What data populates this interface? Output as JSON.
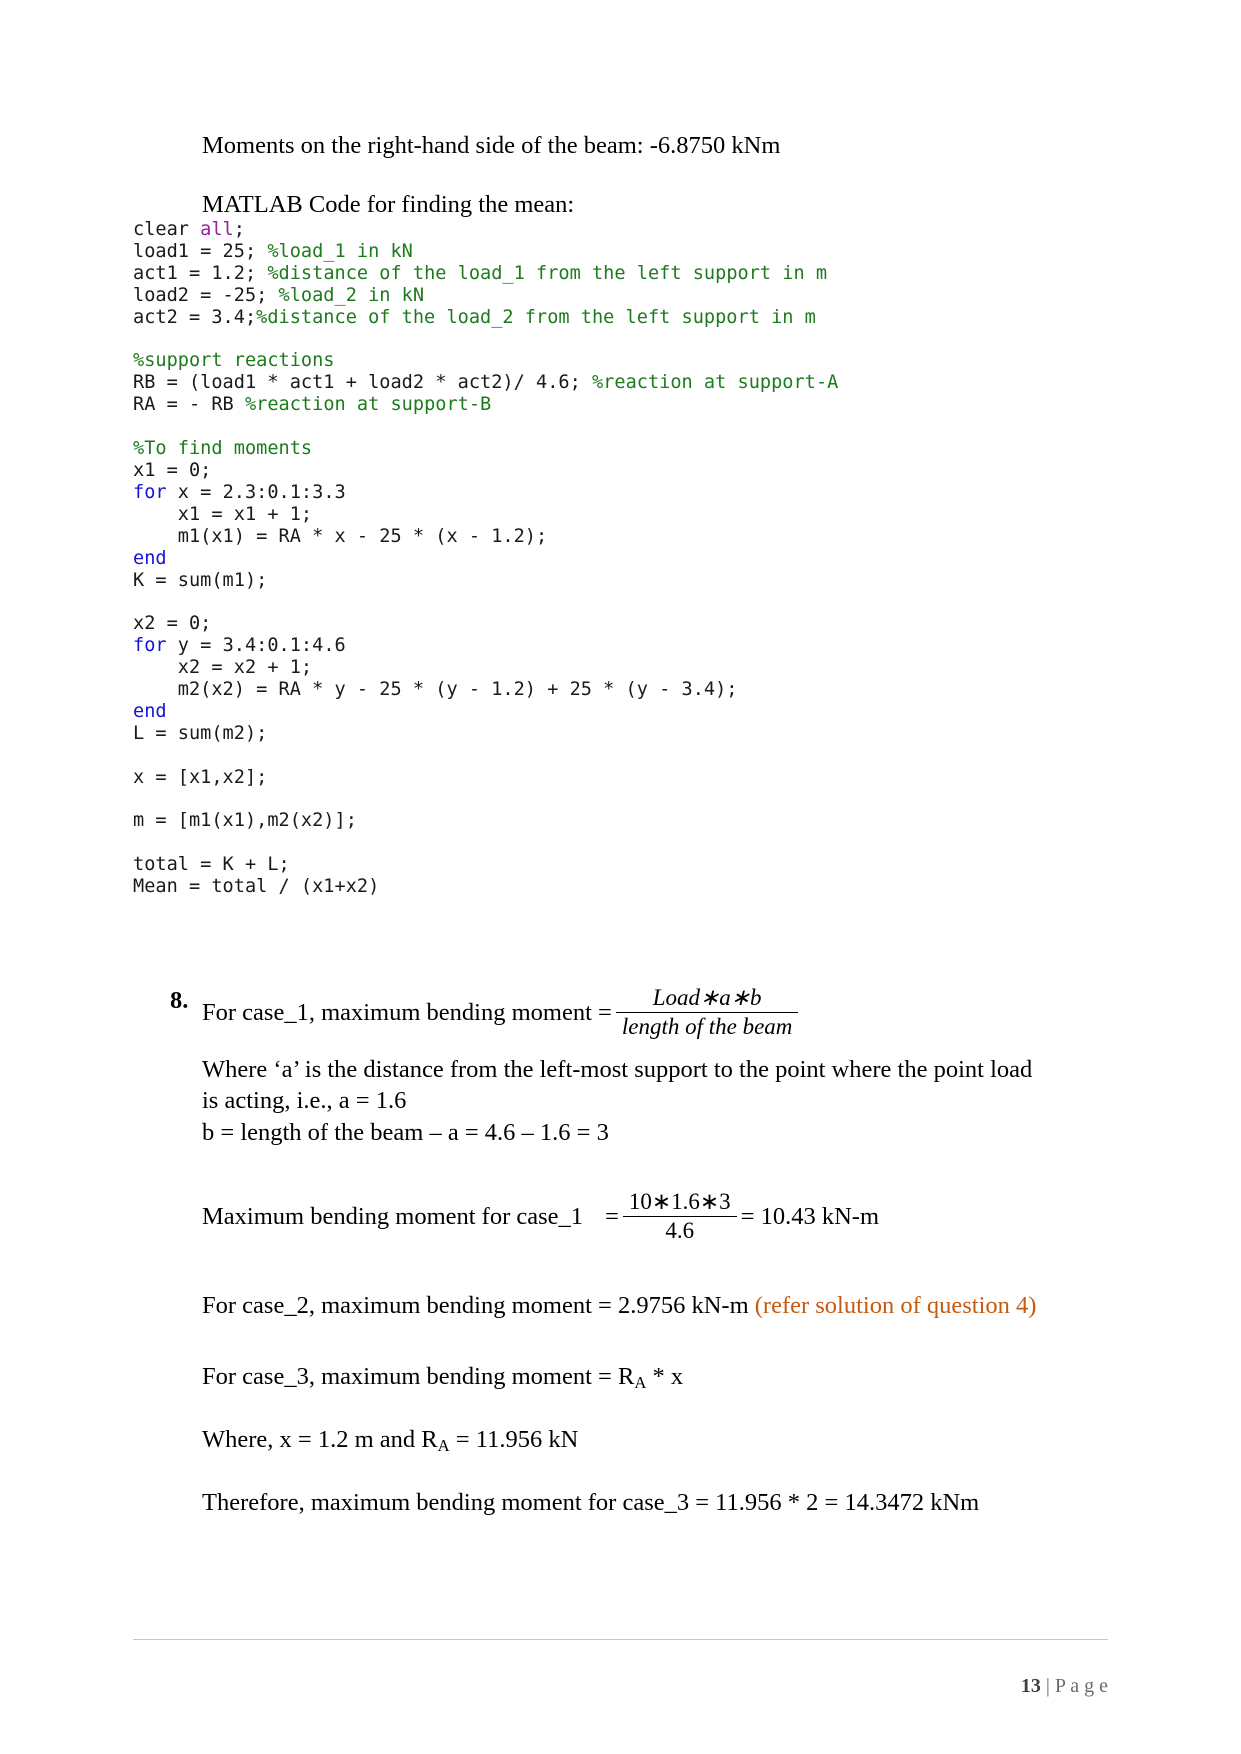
{
  "document": {
    "intro_lines": [
      "Moments on the right-hand side of the beam: -6.8750 kNm",
      "MATLAB Code for finding the mean:"
    ],
    "code": {
      "lines": [
        {
          "segments": [
            {
              "t": "clear ",
              "c": "plain"
            },
            {
              "t": "all",
              "c": "kw2"
            },
            {
              "t": ";",
              "c": "plain"
            }
          ]
        },
        {
          "segments": [
            {
              "t": "load1 = 25; ",
              "c": "plain"
            },
            {
              "t": "%load_1 in kN",
              "c": "cmt"
            }
          ]
        },
        {
          "segments": [
            {
              "t": "act1 = 1.2; ",
              "c": "plain"
            },
            {
              "t": "%distance of the load_1 from the left support in m",
              "c": "cmt"
            }
          ]
        },
        {
          "segments": [
            {
              "t": "load2 = -25; ",
              "c": "plain"
            },
            {
              "t": "%load_2 in kN",
              "c": "cmt"
            }
          ]
        },
        {
          "segments": [
            {
              "t": "act2 = 3.4;",
              "c": "plain"
            },
            {
              "t": "%distance of the load_2 from the left support in m",
              "c": "cmt"
            }
          ]
        },
        {
          "segments": [
            {
              "t": "",
              "c": "plain"
            }
          ]
        },
        {
          "segments": [
            {
              "t": "%support reactions",
              "c": "cmt"
            }
          ]
        },
        {
          "segments": [
            {
              "t": "RB = (load1 * act1 + load2 * act2)/ 4.6; ",
              "c": "plain"
            },
            {
              "t": "%reaction at support-A",
              "c": "cmt"
            }
          ]
        },
        {
          "segments": [
            {
              "t": "RA = - RB ",
              "c": "plain"
            },
            {
              "t": "%reaction at support-B",
              "c": "cmt"
            }
          ]
        },
        {
          "segments": [
            {
              "t": "",
              "c": "plain"
            }
          ]
        },
        {
          "segments": [
            {
              "t": "%To find moments",
              "c": "cmt"
            }
          ]
        },
        {
          "segments": [
            {
              "t": "x1 = 0;",
              "c": "plain"
            }
          ]
        },
        {
          "segments": [
            {
              "t": "for",
              "c": "kw"
            },
            {
              "t": " x = 2.3:0.1:3.3",
              "c": "plain"
            }
          ]
        },
        {
          "segments": [
            {
              "t": "    x1 = x1 + 1;",
              "c": "plain"
            }
          ]
        },
        {
          "segments": [
            {
              "t": "    m1(x1) = RA * x - 25 * (x - 1.2);",
              "c": "plain"
            }
          ]
        },
        {
          "segments": [
            {
              "t": "end",
              "c": "kw"
            }
          ]
        },
        {
          "segments": [
            {
              "t": "K = sum(m1);",
              "c": "plain"
            }
          ]
        },
        {
          "segments": [
            {
              "t": "",
              "c": "plain"
            }
          ]
        },
        {
          "segments": [
            {
              "t": "x2 = 0;",
              "c": "plain"
            }
          ]
        },
        {
          "segments": [
            {
              "t": "for",
              "c": "kw"
            },
            {
              "t": " y = 3.4:0.1:4.6",
              "c": "plain"
            }
          ]
        },
        {
          "segments": [
            {
              "t": "    x2 = x2 + 1;",
              "c": "plain"
            }
          ]
        },
        {
          "segments": [
            {
              "t": "    m2(x2) = RA * y - 25 * (y - 1.2) + 25 * (y - 3.4);",
              "c": "plain"
            }
          ]
        },
        {
          "segments": [
            {
              "t": "end",
              "c": "kw"
            }
          ]
        },
        {
          "segments": [
            {
              "t": "L = sum(m2);",
              "c": "plain"
            }
          ]
        },
        {
          "segments": [
            {
              "t": "",
              "c": "plain"
            }
          ]
        },
        {
          "segments": [
            {
              "t": "x = [x1,x2];",
              "c": "plain"
            }
          ]
        },
        {
          "segments": [
            {
              "t": "",
              "c": "plain"
            }
          ]
        },
        {
          "segments": [
            {
              "t": "m = [m1(x1),m2(x2)];",
              "c": "plain"
            }
          ]
        },
        {
          "segments": [
            {
              "t": "",
              "c": "plain"
            }
          ]
        },
        {
          "segments": [
            {
              "t": "total = K + L;",
              "c": "plain"
            }
          ]
        },
        {
          "segments": [
            {
              "t": "Mean = total / (x1+x2)",
              "c": "plain"
            }
          ]
        }
      ]
    },
    "item8": {
      "number": "8.",
      "lead_text": "For case_1, maximum bending moment = ",
      "formula": {
        "numerator": "Load∗a∗b",
        "denominator": "length of the beam"
      },
      "where_line1": "Where ‘a’ is the distance from the left-most support to the point where the point load",
      "where_line2": "is acting, i.e., a = 1.6",
      "b_line": "b = length of the beam – a = 4.6 – 1.6 = 3",
      "max_bm_case1": {
        "label": "Maximum bending moment for case_1",
        "equals1": "=",
        "numerator": "10∗1.6∗3",
        "denominator": "4.6",
        "equals2": "= 10.43 kN-m"
      },
      "case2_line": "For case_2, maximum bending moment = 2.9756 kN-m",
      "case2_note": "(refer solution of question 4)",
      "case3_line_pre": "For case_3, maximum bending moment = R",
      "case3_sub": "A",
      "case3_line_post": " * x",
      "where_x_pre": "Where, x = 1.2 m and R",
      "where_x_sub": "A",
      "where_x_post": " = 11.956 kN",
      "therefore_line": "Therefore, maximum bending moment for case_3 = 11.956 * 2 = 14.3472 kNm"
    },
    "footer": {
      "page_number": "13",
      "separator": " | ",
      "page_word": "P a g e"
    },
    "colors": {
      "comment_green": "#1e7a1e",
      "keyword_blue": "#1414d2",
      "keyword_purple": "#9421a0",
      "accent_orange": "#c55a11",
      "footer_grey": "#6b6b6b"
    }
  }
}
